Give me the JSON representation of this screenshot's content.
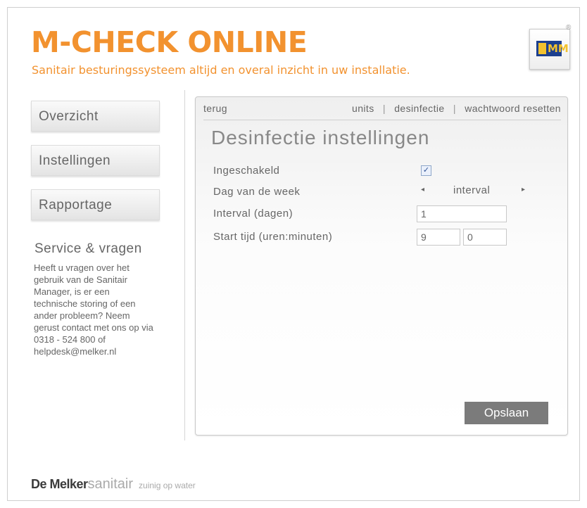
{
  "header": {
    "title": "M-CHECK ONLINE",
    "subtitle": "Sanitair besturingssysteem altijd en overal inzicht in uw installatie.",
    "logo_text": "MM",
    "registered": "®"
  },
  "sidebar": {
    "items": [
      {
        "label": "Overzicht"
      },
      {
        "label": "Instellingen"
      },
      {
        "label": "Rapportage"
      }
    ],
    "service_heading": "Service & vragen",
    "service_text": "Heeft u vragen over het gebruik van de Sanitair Manager, is er een technische storing of een ander probleem? Neem gerust contact met ons op via 0318 - 524 800 of helpdesk@melker.nl"
  },
  "topnav": {
    "back": "terug",
    "links": [
      "units",
      "desinfectie",
      "wachtwoord resetten"
    ],
    "separator": "|"
  },
  "form": {
    "title": "Desinfectie instellingen",
    "enabled_label": "Ingeschakeld",
    "enabled_checked": "✓",
    "day_label": "Dag van de week",
    "day_value": "interval",
    "arrow_left": "◂",
    "arrow_right": "▸",
    "interval_label": "Interval (dagen)",
    "interval_value": "1",
    "start_label": "Start tijd (uren:minuten)",
    "start_hours": "9",
    "start_minutes": "0",
    "save_label": "Opslaan"
  },
  "footer": {
    "brand_bold": "De Melker",
    "brand_light": "sanitair",
    "tagline": "zuinig op water"
  },
  "colors": {
    "accent": "#f2922f",
    "logo_blue": "#1c3f8e",
    "logo_yellow": "#f2c12e",
    "button_gray": "#7b7b7b"
  }
}
